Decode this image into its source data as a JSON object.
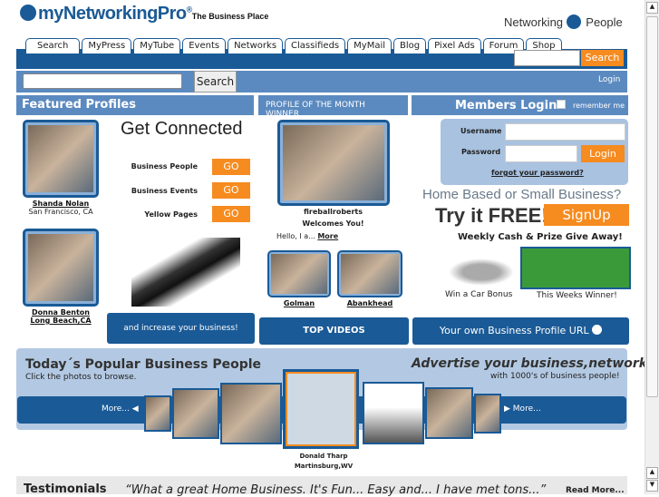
{
  "header": {
    "logo": "myNetworkingPro",
    "registered": "®",
    "tagline": "The Business Place",
    "brand_right_1": "Networking",
    "brand_right_2": "People"
  },
  "nav": {
    "tabs": [
      "Search",
      "MyPress",
      "MyTube",
      "Events",
      "Networks",
      "Classifieds",
      "MyMail",
      "Blog",
      "Pixel Ads",
      "Forum",
      "Shop"
    ],
    "search_button": "Search"
  },
  "subbar": {
    "search_button": "Search",
    "login_link": "Login"
  },
  "featured": {
    "title": "Featured Profiles",
    "profiles": [
      {
        "name": "Shanda Nolan",
        "location": "San Francisco, CA"
      },
      {
        "name": "Donna Benton",
        "location": "Long Beach,CA"
      }
    ]
  },
  "connect": {
    "title": "Get Connected",
    "rows": [
      {
        "label": "Business People",
        "button": "GO"
      },
      {
        "label": "Business Events",
        "button": "GO"
      },
      {
        "label": "Yellow Pages",
        "button": "GO"
      }
    ],
    "banner": "and increase your business!"
  },
  "potm": {
    "title": "PROFILE OF THE MONTH WINNER",
    "username": "fireballroberts",
    "welcome": "Welcomes You!",
    "teaser": "Hello, I a...",
    "more": "More",
    "videos": [
      {
        "name": "Golman"
      },
      {
        "name": "Abankhead"
      }
    ],
    "top_videos": "TOP VIDEOS"
  },
  "login": {
    "title": "Members Login",
    "remember": "remember me",
    "username_label": "Username",
    "password_label": "Password",
    "button": "Login",
    "forgot": "forgot your password?"
  },
  "promo": {
    "headline": "Home Based or Small Business?",
    "try": "Try it FREE!",
    "signup": "SignUp",
    "weekly": "Weekly Cash & Prize Give Away!",
    "car": "Win a Car Bonus",
    "winner": "This Weeks Winner!",
    "profile_url": "Your own Business Profile URL"
  },
  "popular": {
    "title": "Today´s Popular Business People",
    "subtitle": "Click the photos to browse.",
    "advertise": "Advertise your business,network",
    "advertise_sub": "with 1000's of business people!",
    "more_left": "More...",
    "more_right": "More...",
    "selected_name": "Donald Tharp",
    "selected_location": "Martinsburg,WV"
  },
  "testimonials": {
    "title": "Testimonials",
    "quote": "“What a great Home Business. It's Fun... Easy and... I have met tons...”",
    "read_more": "Read More..."
  },
  "colors": {
    "brand_blue": "#1a5a96",
    "light_blue": "#5b8ac0",
    "orange": "#f68b1f"
  }
}
